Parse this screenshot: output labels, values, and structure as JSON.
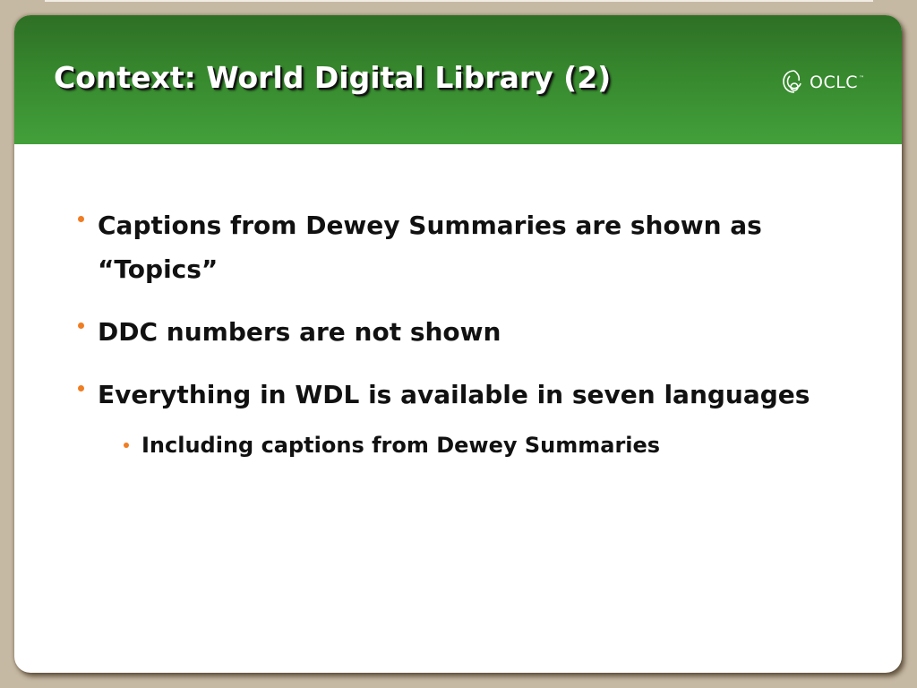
{
  "slide": {
    "title": "Context: World Digital Library (2)",
    "logo": {
      "text": "OCLC",
      "tm": "™",
      "icon": "oclc-logo-icon"
    },
    "bullets": [
      {
        "level": 1,
        "text": "Captions from Dewey Summaries are shown as “Topics”"
      },
      {
        "level": 1,
        "text": "DDC numbers are not shown"
      },
      {
        "level": 1,
        "text": "Everything in WDL is available in seven languages"
      },
      {
        "level": 2,
        "text": "Including captions from Dewey Summaries"
      }
    ]
  },
  "colors": {
    "background": "#c6b9a4",
    "title_bar_top": "#2e6f25",
    "title_bar_bottom": "#42a03a",
    "bullet_accent": "#ef7d22",
    "text": "#111111"
  }
}
